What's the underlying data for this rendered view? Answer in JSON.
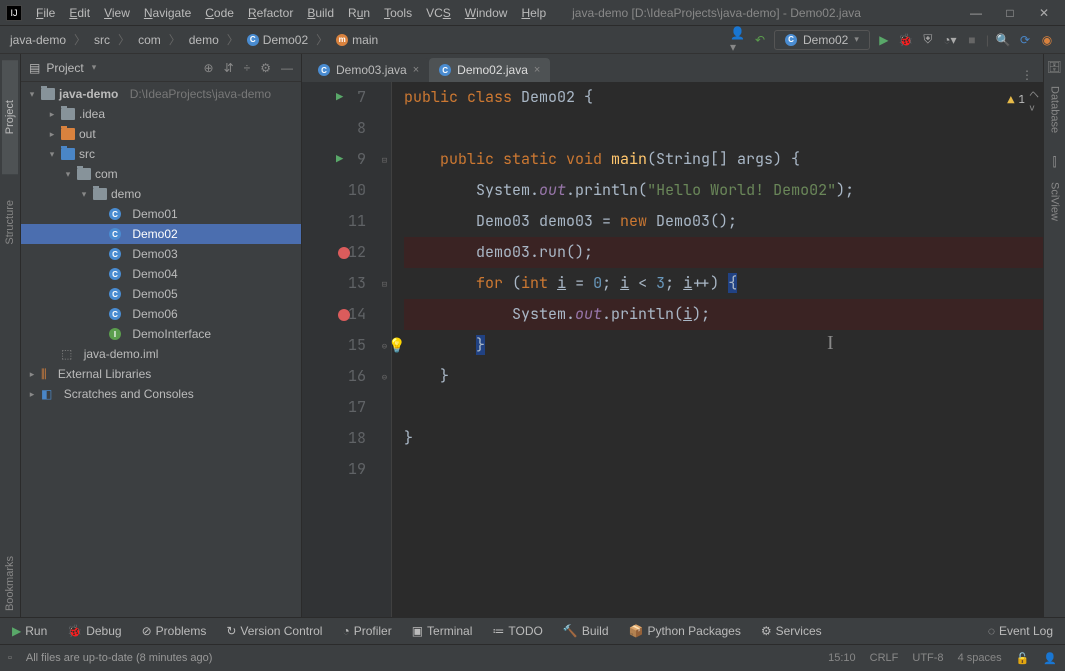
{
  "menu": {
    "file": "File",
    "edit": "Edit",
    "view": "View",
    "navigate": "Navigate",
    "code": "Code",
    "refactor": "Refactor",
    "build": "Build",
    "run": "Run",
    "tools": "Tools",
    "vcs": "VCS",
    "window": "Window",
    "help": "Help"
  },
  "title": "java-demo [D:\\IdeaProjects\\java-demo] - Demo02.java",
  "breadcrumb": [
    "java-demo",
    "src",
    "com",
    "demo",
    "Demo02",
    "main"
  ],
  "runConfig": "Demo02",
  "projectPanel": {
    "title": "Project"
  },
  "tree": {
    "root": "java-demo",
    "rootPath": "D:\\IdeaProjects\\java-demo",
    "idea": ".idea",
    "out": "out",
    "src": "src",
    "com": "com",
    "demo": "demo",
    "files": [
      "Demo01",
      "Demo02",
      "Demo03",
      "Demo04",
      "Demo05",
      "Demo06",
      "DemoInterface"
    ],
    "iml": "java-demo.iml",
    "extLib": "External Libraries",
    "scratches": "Scratches and Consoles"
  },
  "tabs": [
    {
      "name": "Demo03.java"
    },
    {
      "name": "Demo02.java"
    }
  ],
  "lineNumbers": [
    "7",
    "8",
    "9",
    "10",
    "11",
    "12",
    "13",
    "14",
    "15",
    "16",
    "17",
    "18",
    "19"
  ],
  "code": {
    "l7": {
      "pre": "public class ",
      "cls": "Demo02 ",
      "b": "{"
    },
    "l9": {
      "kw": "public static void ",
      "id": "main",
      "sig": "(String[] args) {"
    },
    "l10": {
      "a": "System.",
      "f": "out",
      "b": ".println(",
      "s": "\"Hello World! Demo02\"",
      "c": ");"
    },
    "l11": {
      "a": "Demo03 demo03 = ",
      "kw": "new ",
      "b": "Demo03();"
    },
    "l12": {
      "a": "demo03.run();"
    },
    "l13": {
      "kw1": "for ",
      "p1": "(",
      "kw2": "int ",
      "v": "i",
      "eq": " = ",
      "n1": "0",
      "s1": "; ",
      "v2": "i",
      "lt": " < ",
      "n2": "3",
      "s2": "; ",
      "v3": "i",
      "inc": "++) ",
      "b": "{"
    },
    "l14": {
      "a": "System.",
      "f": "out",
      "b": ".println(",
      "v": "i",
      "c": ");"
    },
    "l15": {
      "b": "}"
    },
    "l16": {
      "b": "}"
    },
    "l18": {
      "b": "}"
    }
  },
  "warnings": "1",
  "leftRail": [
    "Project",
    "Structure",
    "Bookmarks"
  ],
  "rightRail": [
    "Database",
    "SciView"
  ],
  "bottomBar": {
    "run": "Run",
    "debug": "Debug",
    "problems": "Problems",
    "vc": "Version Control",
    "profiler": "Profiler",
    "terminal": "Terminal",
    "todo": "TODO",
    "build": "Build",
    "py": "Python Packages",
    "services": "Services",
    "eventLog": "Event Log"
  },
  "status": {
    "msg": "All files are up-to-date (8 minutes ago)",
    "pos": "15:10",
    "eol": "CRLF",
    "enc": "UTF-8",
    "indent": "4 spaces"
  }
}
